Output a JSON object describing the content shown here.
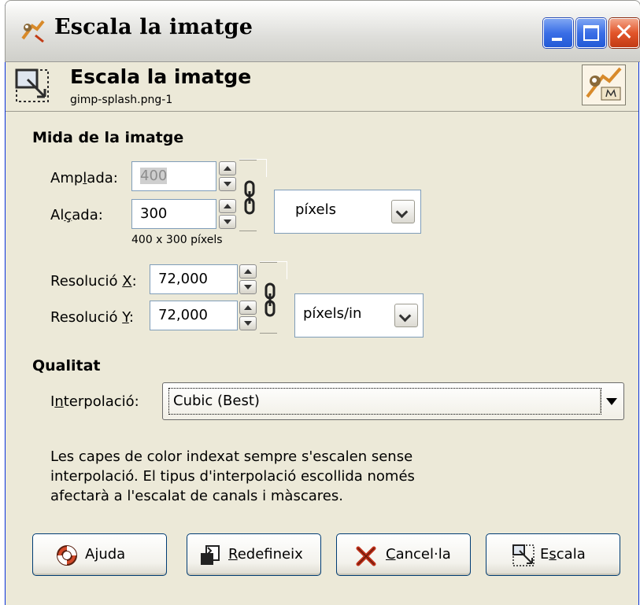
{
  "window": {
    "title": "Escala la imatge"
  },
  "header": {
    "title": "Escala la imatge",
    "subtitle": "gimp-splash.png-1"
  },
  "size_section": {
    "title": "Mida de la imatge",
    "width_label_pre": "Amp",
    "width_label_mn": "l",
    "width_label_post": "ada:",
    "width_value": "400",
    "height_label_pre": "Al",
    "height_label_mn": "ç",
    "height_label_post": "ada:",
    "height_value": "300",
    "unit": "píxels",
    "size_summary": "400 x 300 píxels",
    "res_x_label_pre": "Resolució ",
    "res_x_label_mn": "X",
    "res_x_label_post": ":",
    "res_x_value": "72,000",
    "res_y_label_pre": "Resolució ",
    "res_y_label_mn": "Y",
    "res_y_label_post": ":",
    "res_y_value": "72,000",
    "res_unit": "píxels/in"
  },
  "quality_section": {
    "title": "Qualitat",
    "interp_label_pre": "I",
    "interp_label_mn": "n",
    "interp_label_post": "terpolació:",
    "interp_value": "Cubic (Best)",
    "note_line1": "Les capes de color indexat sempre s'escalen sense",
    "note_line2": "interpolació. El tipus d'interpolació escollida només",
    "note_line3": "afectarà a l'escalat de canals i màscares."
  },
  "buttons": {
    "help": "Ajuda",
    "reset_mn": "R",
    "reset_rest": "edefineix",
    "cancel_mn": "C",
    "cancel_rest": "ancel·la",
    "scale_pre": "E",
    "scale_mn": "s",
    "scale_post": "cala"
  },
  "icons": {
    "app": "gimp-wilber-icon",
    "scale": "scale-tool-icon",
    "chain": "chain-link-icon",
    "help": "lifebuoy-icon",
    "reset": "reset-icon",
    "cancel": "cancel-x-icon"
  },
  "colors": {
    "dialog_bg": "#ECE9D8",
    "title_blue_button": "#235AD6",
    "close_button": "#C23B15",
    "field_border": "#7F9DB9"
  }
}
